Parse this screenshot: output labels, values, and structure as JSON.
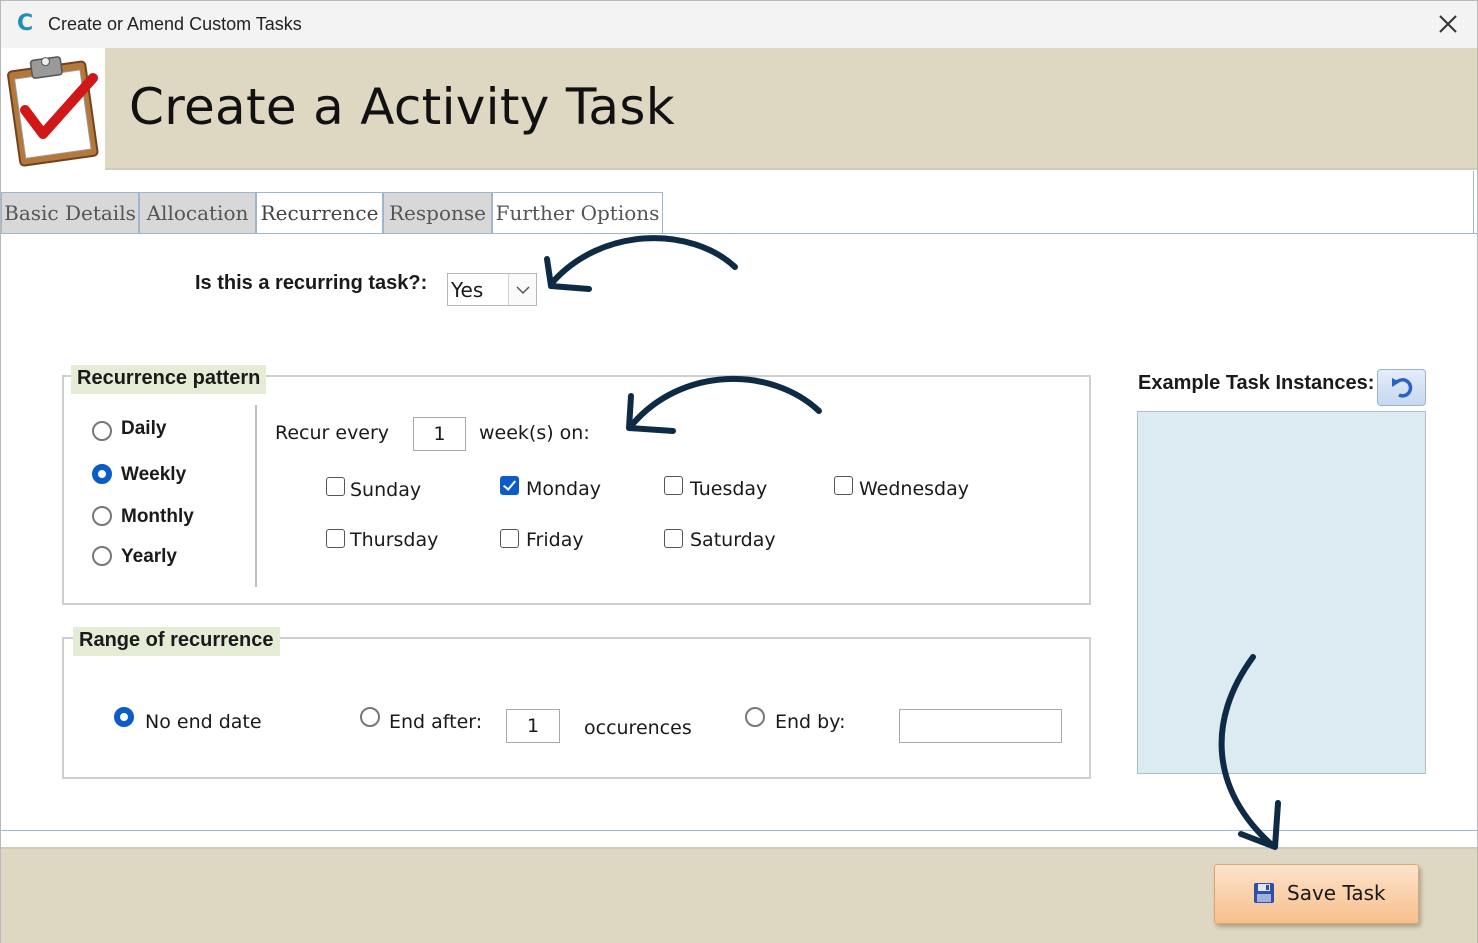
{
  "window": {
    "title": "Create or Amend Custom Tasks",
    "app_icon_glyph": "C",
    "close_glyph": "✕"
  },
  "header": {
    "title": "Create a Activity Task",
    "logo_icon": "clipboard-checkmark-icon"
  },
  "tabs": [
    {
      "label": "Basic Details",
      "active": false
    },
    {
      "label": "Allocation",
      "active": false
    },
    {
      "label": "Recurrence",
      "active": true
    },
    {
      "label": "Response",
      "active": false
    },
    {
      "label": "Further Options",
      "active": false
    }
  ],
  "recurring": {
    "label": "Is this a recurring task?:",
    "value": "Yes"
  },
  "recurrence_pattern": {
    "legend": "Recurrence pattern",
    "options": [
      {
        "label": "Daily",
        "checked": false
      },
      {
        "label": "Weekly",
        "checked": true
      },
      {
        "label": "Monthly",
        "checked": false
      },
      {
        "label": "Yearly",
        "checked": false
      }
    ],
    "recur_every_label": "Recur every",
    "recur_every_value": "1",
    "weeks_on_label": "week(s) on:",
    "days": [
      {
        "label": "Sunday",
        "checked": false
      },
      {
        "label": "Monday",
        "checked": true
      },
      {
        "label": "Tuesday",
        "checked": false
      },
      {
        "label": "Wednesday",
        "checked": false
      },
      {
        "label": "Thursday",
        "checked": false
      },
      {
        "label": "Friday",
        "checked": false
      },
      {
        "label": "Saturday",
        "checked": false
      }
    ]
  },
  "range": {
    "legend": "Range of recurrence",
    "no_end_label": "No end date",
    "no_end_checked": true,
    "end_after_label": "End after:",
    "end_after_checked": false,
    "end_after_value": "1",
    "occurrences_label": "occurences",
    "end_by_label": "End by:",
    "end_by_checked": false,
    "end_by_value": ""
  },
  "example": {
    "label": "Example Task Instances:",
    "refresh_icon": "refresh-icon"
  },
  "footer": {
    "save_label": "Save Task",
    "save_icon": "floppy-disk-icon"
  },
  "colors": {
    "header_bg": "#ded8c2",
    "legend_bg": "#e5ecd6",
    "accent_blue": "#0b5cc9",
    "example_bg": "#dcebf2",
    "save_btn": "#f7bf8c",
    "arrow": "#0e2a44"
  }
}
